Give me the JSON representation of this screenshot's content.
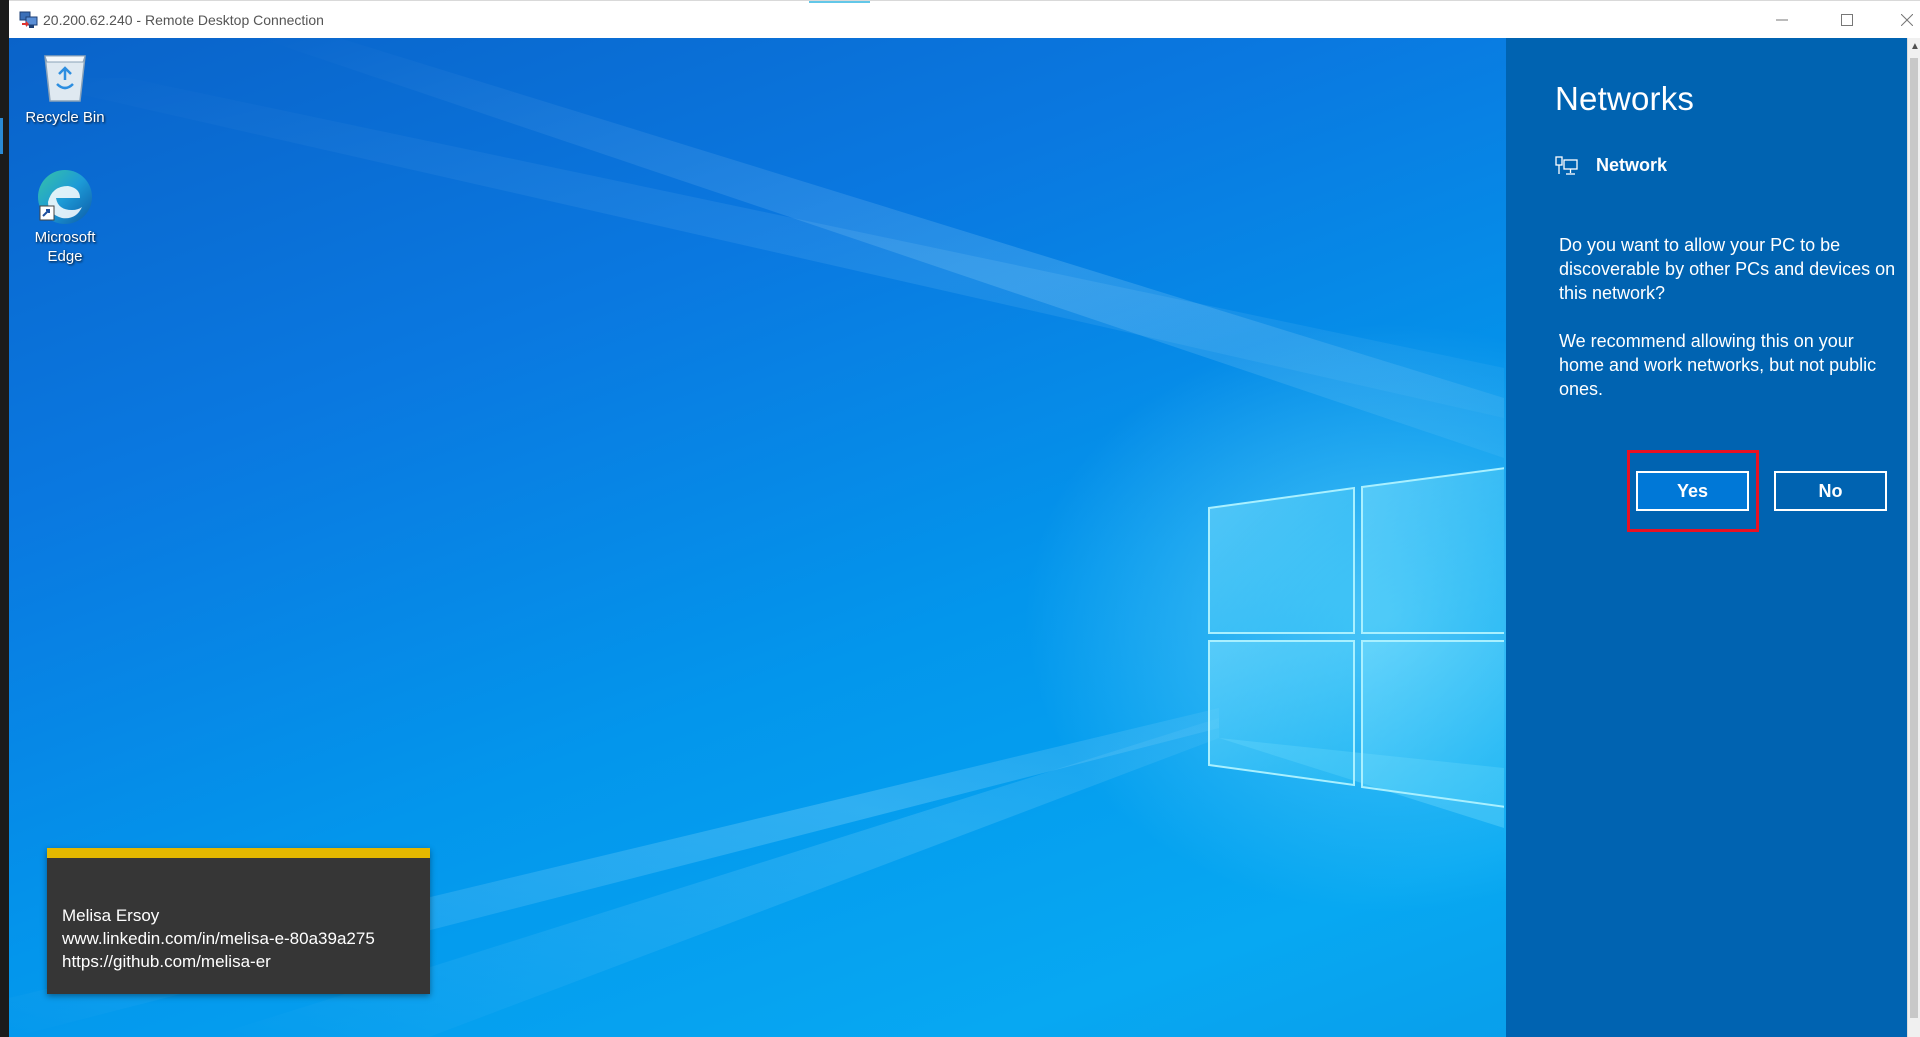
{
  "window": {
    "title": "20.200.62.240 - Remote Desktop Connection",
    "controls": {
      "minimize": "—",
      "maximize": "☐",
      "close": "✕"
    }
  },
  "desktop": {
    "icons": [
      {
        "label": "Recycle Bin",
        "icon": "recycle-bin-icon"
      },
      {
        "label": "Microsoft Edge",
        "icon": "edge-icon"
      }
    ]
  },
  "networks_panel": {
    "title": "Networks",
    "network_name": "Network",
    "network_icon": "network-computer-icon",
    "question": "Do you want to allow your PC to be discoverable by other PCs and devices on this network?",
    "recommendation": "We recommend allowing this on your home and work networks, but not public ones.",
    "yes_label": "Yes",
    "no_label": "No",
    "highlight_color": "#e81123"
  },
  "caption": {
    "name": "Melisa Ersoy",
    "linkedin": "www.linkedin.com/in/melisa-e-80a39a275",
    "github": "https://github.com/melisa-er"
  },
  "colors": {
    "panel_background": "#0063b1",
    "yes_button": "#0078d7",
    "caption_stripe": "#e3b800",
    "caption_background": "#363636"
  }
}
